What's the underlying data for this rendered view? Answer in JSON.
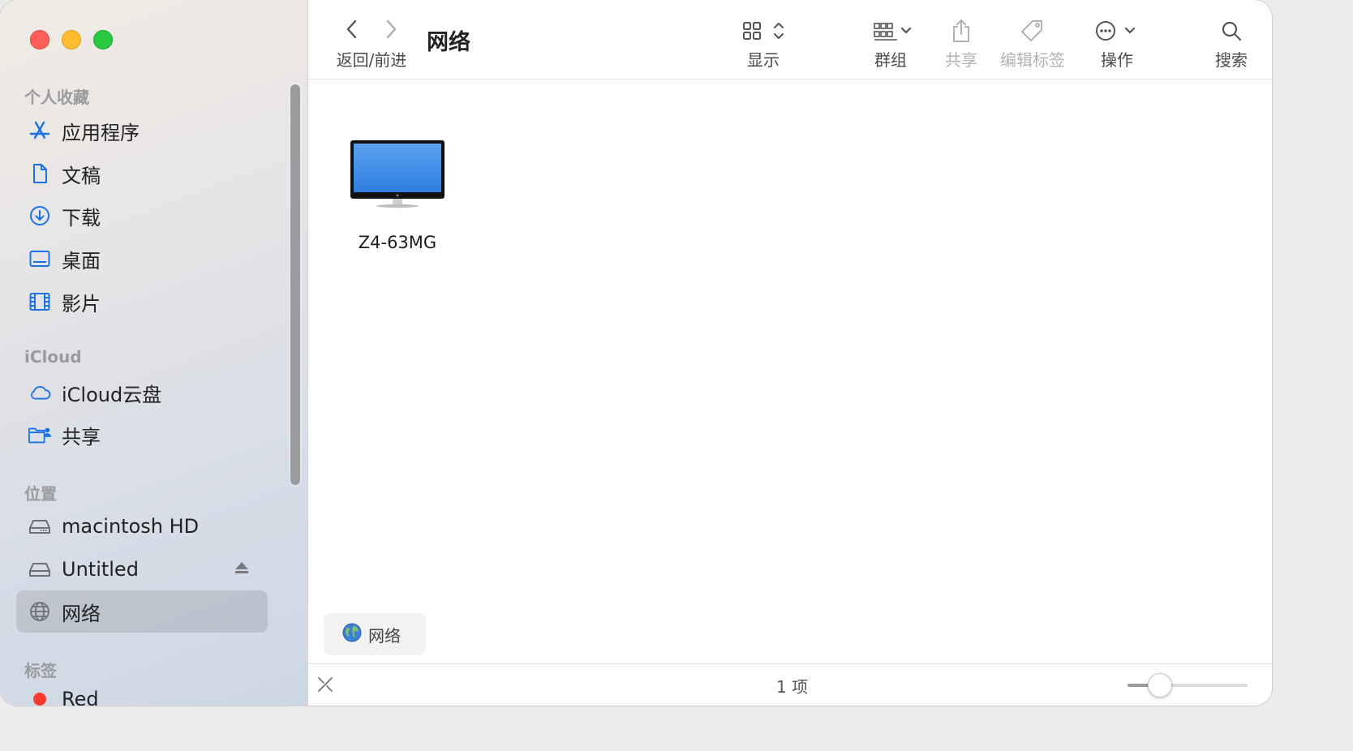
{
  "window": {
    "title": "网络"
  },
  "sidebar": {
    "sections": [
      {
        "title": "个人收藏",
        "items": [
          {
            "label": "应用程序",
            "icon": "applications-icon"
          },
          {
            "label": "文稿",
            "icon": "document-icon"
          },
          {
            "label": "下载",
            "icon": "download-icon"
          },
          {
            "label": "桌面",
            "icon": "desktop-icon"
          },
          {
            "label": "影片",
            "icon": "film-icon"
          }
        ]
      },
      {
        "title": "iCloud",
        "items": [
          {
            "label": "iCloud云盘",
            "icon": "cloud-icon"
          },
          {
            "label": "共享",
            "icon": "shared-folder-icon"
          }
        ]
      },
      {
        "title": "位置",
        "items": [
          {
            "label": "macintosh HD",
            "icon": "drive-icon"
          },
          {
            "label": "Untitled",
            "icon": "drive-icon",
            "eject": true
          },
          {
            "label": "网络",
            "icon": "globe-icon",
            "selected": true
          }
        ]
      },
      {
        "title": "标签",
        "items": [
          {
            "label": "Red",
            "icon": "red-tag-icon",
            "color": "#ff3b30"
          }
        ]
      }
    ]
  },
  "toolbar": {
    "nav_label": "返回/前进",
    "view_label": "显示",
    "group_label": "群组",
    "share_label": "共享",
    "tags_label": "编辑标签",
    "action_label": "操作",
    "search_label": "搜索"
  },
  "content": {
    "items": [
      {
        "name": "Z4-63MG",
        "icon": "computer-icon"
      }
    ]
  },
  "pathbar": {
    "label": "网络"
  },
  "statusbar": {
    "count_text": "1 项",
    "icon_size_fraction": 0.27
  },
  "colors": {
    "accent": "#1a73e8",
    "close": "#ff5f57",
    "minimize": "#febc2e",
    "zoom": "#28c840"
  }
}
